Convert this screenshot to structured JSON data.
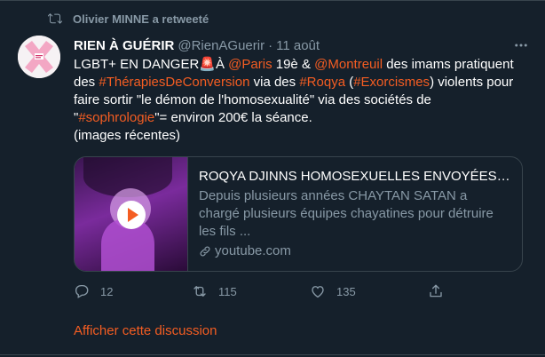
{
  "retweet": {
    "icon": "retweet-icon",
    "label": "Olivier MINNE a retweeté"
  },
  "author": {
    "name": "RIEN À GUÉRIR",
    "handle": "@RienAGuerir",
    "separator": "·",
    "date": "11 août",
    "avatar_icon": "x-logo-avatar"
  },
  "more_icon": "more-horizontal-icon",
  "tweet": {
    "segments": [
      {
        "text": "LGBT+ EN DANGER",
        "kind": "text"
      },
      {
        "text": "🚨",
        "kind": "emoji"
      },
      {
        "text": "À ",
        "kind": "text"
      },
      {
        "text": "@Paris",
        "kind": "link"
      },
      {
        "text": " 19è & ",
        "kind": "text"
      },
      {
        "text": "@Montreuil",
        "kind": "link"
      },
      {
        "text": " des imams pratiquent des ",
        "kind": "text"
      },
      {
        "text": "#ThérapiesDeConversion",
        "kind": "link"
      },
      {
        "text": " via des ",
        "kind": "text"
      },
      {
        "text": "#Roqya",
        "kind": "link"
      },
      {
        "text": " (",
        "kind": "text"
      },
      {
        "text": "#Exorcismes",
        "kind": "link"
      },
      {
        "text": ") violents pour faire sortir \"le démon de l'homosexualité\" via des sociétés de \"",
        "kind": "text"
      },
      {
        "text": "#sophrologie",
        "kind": "link"
      },
      {
        "text": "\"= environ 200€ la séance.",
        "kind": "text"
      }
    ],
    "note": "(images récentes)"
  },
  "card": {
    "title": "ROQYA DJINNS HOMOSEXUELLES ENVOYÉES CO...",
    "description": "Depuis plusieurs années CHAYTAN SATAN a chargé plusieurs équipes chayatines pour détruire les fils ...",
    "domain": "youtube.com",
    "play_icon": "play-icon",
    "link_icon": "link-icon"
  },
  "actions": {
    "reply": {
      "icon": "reply-icon",
      "count": "12"
    },
    "retweet": {
      "icon": "retweet-icon",
      "count": "115"
    },
    "like": {
      "icon": "heart-icon",
      "count": "135"
    },
    "share": {
      "icon": "share-icon"
    }
  },
  "show_thread": "Afficher cette discussion",
  "colors": {
    "background": "#15202b",
    "accent": "#f45d22",
    "muted": "#8899a6",
    "border": "#38444d",
    "text": "#ffffff"
  }
}
